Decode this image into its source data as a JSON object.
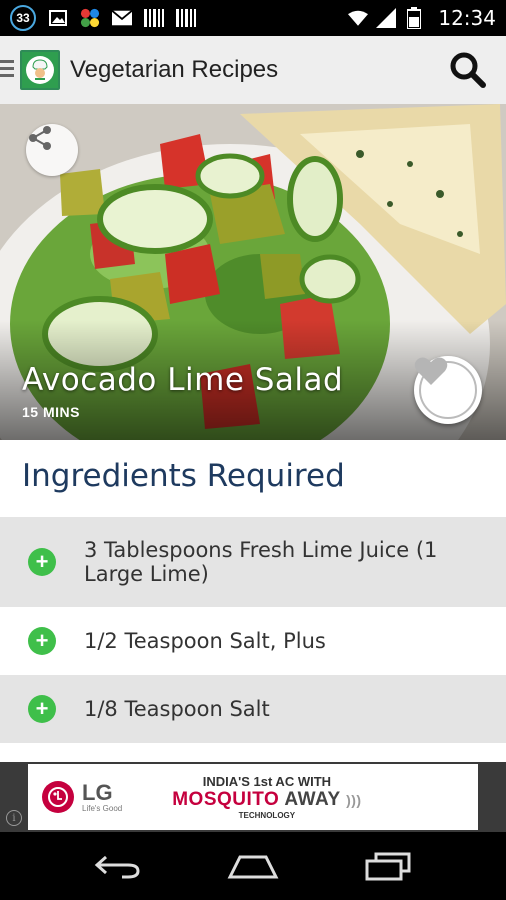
{
  "status_bar": {
    "notification_count": "33",
    "time": "12:34",
    "icons": [
      "image-icon",
      "app-grid-icon",
      "mail-icon",
      "barcode-icon",
      "barcode-icon",
      "wifi-icon",
      "signal-icon",
      "battery-icon"
    ]
  },
  "app_bar": {
    "title": "Vegetarian Recipes",
    "icons": [
      "menu-icon",
      "app-logo-icon",
      "search-icon"
    ]
  },
  "recipe": {
    "title": "Avocado Lime Salad",
    "time": "15 MINS",
    "icons": [
      "share-icon",
      "heart-icon"
    ]
  },
  "ingredients": {
    "heading": "Ingredients Required",
    "items": [
      {
        "text": "3 Tablespoons  Fresh Lime Juice (1 Large Lime)"
      },
      {
        "text": "1/2 Teaspoon  Salt, Plus"
      },
      {
        "text": "1/8 Teaspoon  Salt"
      }
    ]
  },
  "ad": {
    "brand": "LG",
    "tagline": "Life's Good",
    "line1": "INDIA'S 1st AC WITH",
    "line2a": "MOSQUITO",
    "line2b": "AWAY",
    "line3": "TECHNOLOGY",
    "info": "i"
  },
  "nav_bar": {
    "icons": [
      "back-icon",
      "home-icon",
      "recents-icon"
    ]
  },
  "colors": {
    "accent_green": "#3fbf4a",
    "heading_blue": "#1e3a5f",
    "ad_red": "#c5003e"
  }
}
